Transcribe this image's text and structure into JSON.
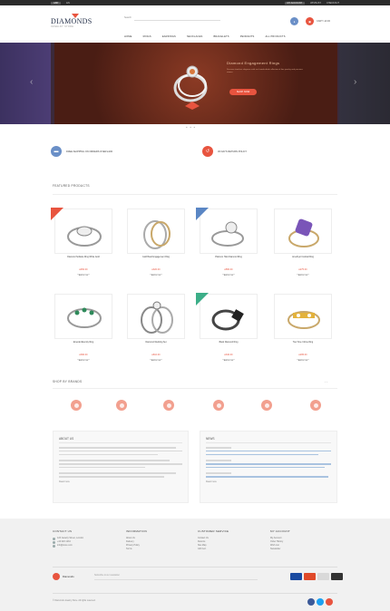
{
  "topbar": {
    "left": [
      "GBP",
      "EN"
    ],
    "right": [
      "MY ACCOUNT",
      "WISHLIST",
      "CHECKOUT"
    ]
  },
  "header": {
    "logo_name": "DIAMONDS",
    "logo_tag": "JEWELRY STORE",
    "search_label": "Search",
    "cart_label": "CART / £0.00",
    "nav": [
      "HOME",
      "RINGS",
      "EARRINGS",
      "NECKLACES",
      "BRACELETS",
      "PENDANTS",
      "ALL PRODUCTS"
    ]
  },
  "hero": {
    "title": "Diamond Engagement Rings",
    "description": "Discover timeless elegance with our handcrafted collection of fine jewelry and precious stones.",
    "button": "SHOP NOW",
    "prev": "‹",
    "next": "›",
    "dots": "● ● ●"
  },
  "features": [
    {
      "icon": "truck-icon",
      "text": "FREE SHIPPING ON ORDERS OVER £100",
      "color": "#6a8fc7"
    },
    {
      "icon": "return-icon",
      "text": "30 DAYS RETURN POLICY",
      "color": "#e8543f"
    }
  ],
  "featured_title": "FEATURED PRODUCTS",
  "products": [
    {
      "name": "Diamond Solitaire Ring White Gold",
      "price": "£450.00",
      "cart": "Add to cart",
      "ribbon": "#e8543f"
    },
    {
      "name": "Gold Band Engagement Ring",
      "price": "£320.00",
      "cart": "Add to cart",
      "ribbon": ""
    },
    {
      "name": "Platinum Halo Diamond Ring",
      "price": "£580.00",
      "cart": "Add to cart",
      "ribbon": "#5a86c4"
    },
    {
      "name": "Amethyst Cocktail Ring",
      "price": "£275.00",
      "cart": "Add to cart",
      "ribbon": ""
    },
    {
      "name": "Emerald Eternity Ring",
      "price": "£390.00",
      "cart": "Add to cart",
      "ribbon": ""
    },
    {
      "name": "Diamond Wedding Set",
      "price": "£610.00",
      "cart": "Add to cart",
      "ribbon": ""
    },
    {
      "name": "Black Diamond Ring",
      "price": "£340.00",
      "cart": "Add to cart",
      "ribbon": "#3cae88"
    },
    {
      "name": "Two Tone Citrine Ring",
      "price": "£295.00",
      "cart": "Add to cart",
      "ribbon": ""
    }
  ],
  "brands_title": "SHOP BY BRANDS",
  "brand_arrows": "‹ ›",
  "about": {
    "title": "ABOUT US",
    "text": "Read more"
  },
  "news": {
    "title": "NEWS",
    "text": "Read more"
  },
  "footer": {
    "columns": [
      {
        "title": "CONTACT US",
        "items": [
          "123 Jewelry Street, London",
          "+44 020 1234",
          "info@store.com"
        ]
      },
      {
        "title": "INFORMATION",
        "items": [
          "About Us",
          "Delivery",
          "Privacy Policy",
          "Terms"
        ]
      },
      {
        "title": "CUSTOMER SERVICE",
        "items": [
          "Contact Us",
          "Returns",
          "Site Map",
          "Gift Cert."
        ]
      },
      {
        "title": "MY ACCOUNT",
        "items": [
          "My Account",
          "Order History",
          "Wish List",
          "Newsletter"
        ]
      }
    ],
    "logo": "Diamonds",
    "newsletter_placeholder": "Subscribe to our newsletter",
    "copyright": "© Diamonds Jewelry Store. All rights reserved.",
    "card_colors": [
      "#1a4aa0",
      "#e04a2a",
      "#d9d9d9",
      "#333333"
    ],
    "social_colors": [
      "#3b5998",
      "#1da1f2",
      "#e8543f"
    ]
  },
  "colors": {
    "accent": "#e8543f",
    "blue": "#6a8fc7"
  }
}
